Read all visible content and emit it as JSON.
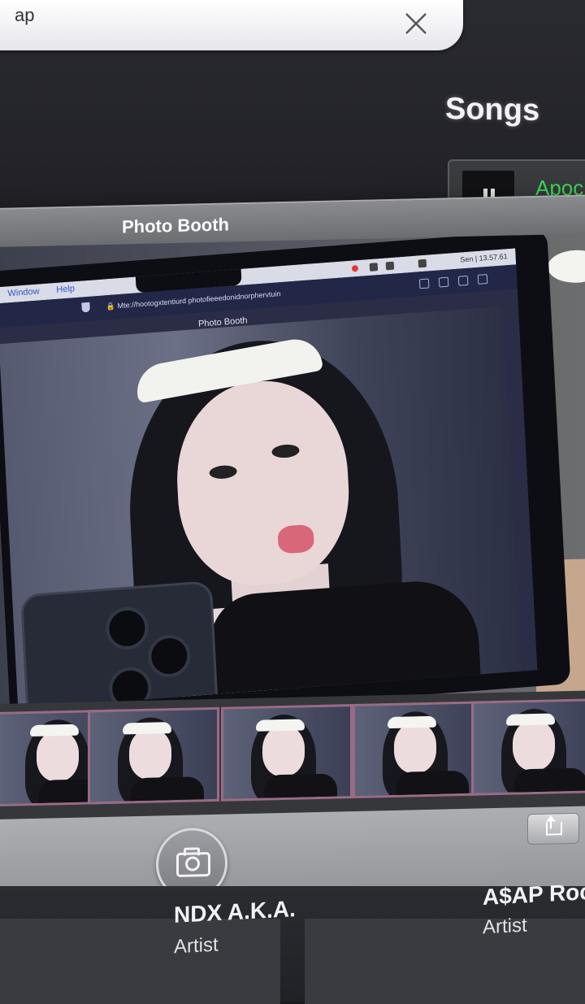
{
  "search": {
    "query": "ap"
  },
  "music": {
    "section_title": "Songs",
    "now_playing_title": "Apoc"
  },
  "photo_booth": {
    "window_title": "Photo Booth",
    "inner_screen": {
      "menu_items": [
        "Window",
        "Help"
      ],
      "clock": "Sen | 13.57.61",
      "url": "Mte://hootogxtentiurd photofieeedonidnorphervtuin",
      "inner_title": "Photo Booth"
    },
    "thumbnail_count": 5
  },
  "artists": [
    {
      "name": "NDX A.K.A.",
      "role": "Artist"
    },
    {
      "name": "A$AP Rock",
      "role": "Artist"
    }
  ],
  "icons": {
    "clear": "close-icon",
    "pause": "pause-icon",
    "camera": "camera-icon",
    "share": "share-icon"
  },
  "colors": {
    "now_playing_accent": "#3fdc5a",
    "thumbnail_border": "#9a6b86"
  }
}
